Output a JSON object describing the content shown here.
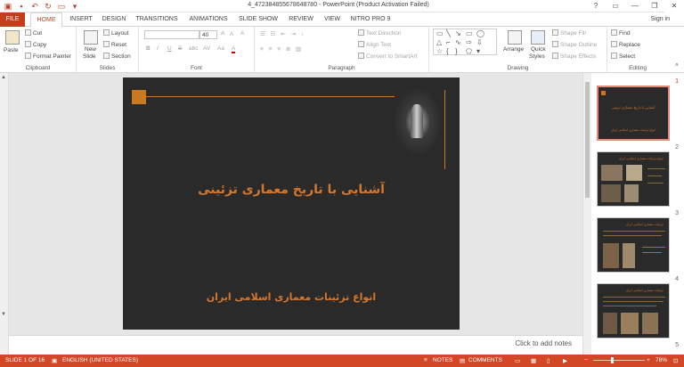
{
  "window": {
    "title": "4_472384855678648780  -  PowerPoint (Product Activation Failed)",
    "help": "?",
    "minimize": "—",
    "restore": "❐",
    "close": "✕"
  },
  "tabs": [
    "FILE",
    "HOME",
    "INSERT",
    "DESIGN",
    "TRANSITIONS",
    "ANIMATIONS",
    "SLIDE SHOW",
    "REVIEW",
    "VIEW",
    "NITRO PRO 9"
  ],
  "sign_in": "Sign in",
  "ribbon": {
    "clipboard": {
      "paste": "Paste",
      "cut": "Cut",
      "copy": "Copy",
      "format_painter": "Format Painter",
      "label": "Clipboard"
    },
    "slides": {
      "new_slide": "New",
      "new_slide2": "Slide",
      "layout": "Layout",
      "reset": "Reset",
      "section": "Section",
      "label": "Slides"
    },
    "font": {
      "font_name": "",
      "font_size": "40",
      "bold": "B",
      "italic": "I",
      "underline": "U",
      "strike": "S",
      "shadow": "abc",
      "spacing": "AV",
      "case": "Aa",
      "color": "A",
      "grow": "A",
      "shrink": "A",
      "clear": "A",
      "label": "Font"
    },
    "paragraph": {
      "text_direction": "Text Direction",
      "align_text": "Align Text",
      "smartart": "Convert to SmartArt",
      "label": "Paragraph"
    },
    "drawing": {
      "arrange": "Arrange",
      "quick_styles": "Quick",
      "quick_styles2": "Styles",
      "shape_fill": "Shape Fill",
      "shape_outline": "Shape Outline",
      "shape_effects": "Shape Effects",
      "label": "Drawing"
    },
    "editing": {
      "find": "Find",
      "replace": "Replace",
      "select": "Select",
      "label": "Editing"
    }
  },
  "slide": {
    "title": "آشنایی با تاریخ معماری تزئینی",
    "subtitle": "انواع تزئینات معماری اسلامی ایران"
  },
  "notes_placeholder": "Click to add notes",
  "thumbnails": [
    {
      "num": "1",
      "title": "آشنایی با تاریخ معماری تزئینی",
      "sub": "انواع تزئینات معماری اسلامی ایران"
    },
    {
      "num": "2",
      "head": "انواع تزئینات معماری اسلامی ایران"
    },
    {
      "num": "3",
      "head": "تزئینات معماری اسلامی ایران"
    },
    {
      "num": "4",
      "head": "تزئینات معماری اسلامی ایران"
    },
    {
      "num": "5"
    }
  ],
  "status": {
    "slide_of": "SLIDE 1 OF 16",
    "language": "ENGLISH (UNITED STATES)",
    "notes": "NOTES",
    "comments": "COMMENTS",
    "zoom": "78%"
  },
  "colors": {
    "accent": "#d24726",
    "slide_bg": "#2a2a2a",
    "slide_text": "#d8772a"
  }
}
